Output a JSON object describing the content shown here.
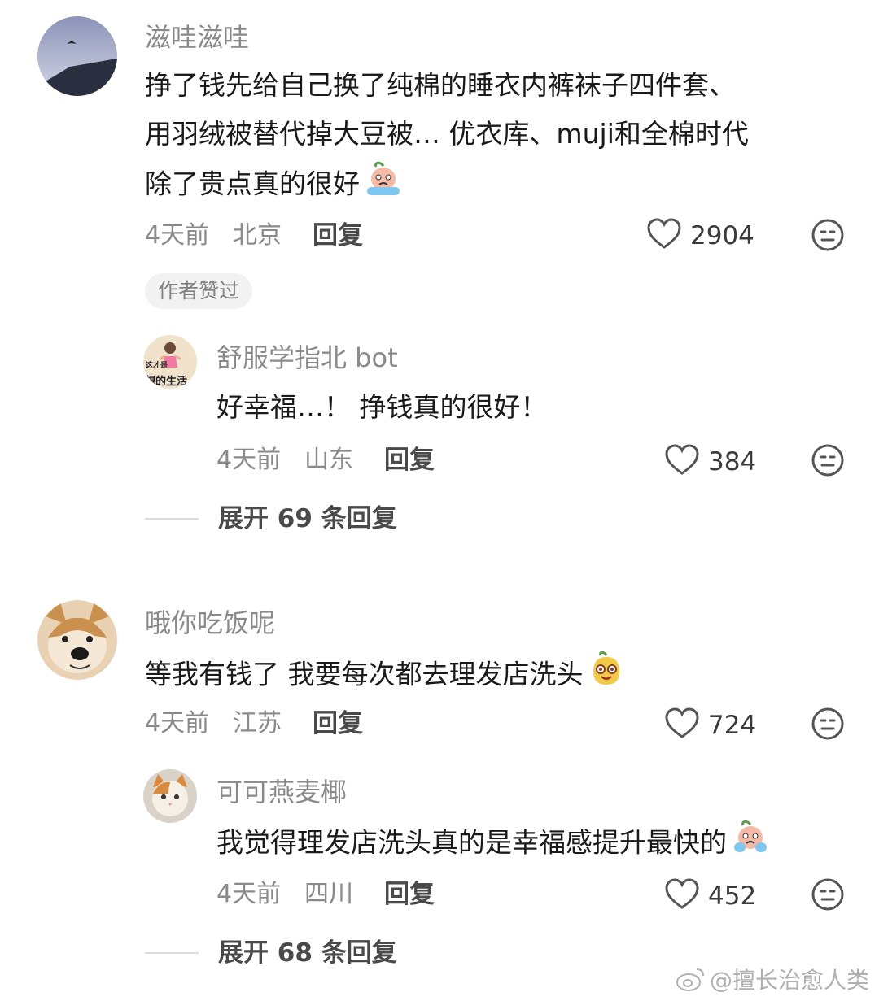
{
  "comments": [
    {
      "username": "滋哇滋哇",
      "lines": [
        "挣了钱先给自己换了纯棉的睡衣内裤袜子四件套、",
        "用羽绒被替代掉大豆被… 优衣库、muji和全棉时代",
        "除了贵点真的很好"
      ],
      "emoji": "crying-face-emoji",
      "time": "4天前",
      "location": "北京",
      "reply_label": "回复",
      "likes": "2904",
      "badge": "作者赞过",
      "reply": {
        "username": "舒服学指北 bot",
        "avatar_text_top": "这才是",
        "avatar_text_bottom": "想的生活",
        "text": "好幸福…！ 挣钱真的很好！",
        "time": "4天前",
        "location": "山东",
        "reply_label": "回复",
        "likes": "384"
      },
      "expand_label": "展开 69 条回复"
    },
    {
      "username": "哦你吃饭呢",
      "text": "等我有钱了 我要每次都去理发店洗头",
      "emoji": "happy-face-emoji",
      "time": "4天前",
      "location": "江苏",
      "reply_label": "回复",
      "likes": "724",
      "reply": {
        "username": "可可燕麦椰",
        "text": "我觉得理发店洗头真的是幸福感提升最快的",
        "emoji": "crying-face-emoji",
        "time": "4天前",
        "location": "四川",
        "reply_label": "回复",
        "likes": "452"
      },
      "expand_label": "展开 68 条回复"
    }
  ],
  "watermark": "@擅长治愈人类",
  "icons": {
    "like": "heart-icon",
    "dislike": "meh-face-icon",
    "platform": "weibo-logo-icon"
  }
}
